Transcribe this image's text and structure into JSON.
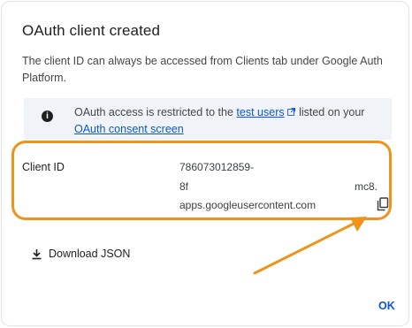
{
  "dialog": {
    "title": "OAuth client created",
    "description": "The client ID can always be accessed from Clients tab under Google Auth Platform."
  },
  "notice": {
    "icon": "info-icon",
    "text_before_link": "OAuth access is restricted to the ",
    "test_users_link": "test users",
    "text_between": " listed on your ",
    "consent_link": "OAuth consent screen"
  },
  "client": {
    "label": "Client ID",
    "line1": "786073012859-",
    "line2": "8f",
    "line2_tail": "mc8.",
    "line3": "apps.googleusercontent.com",
    "copy_icon": "copy-icon"
  },
  "actions": {
    "download_label": "Download JSON",
    "ok_label": "OK"
  },
  "annotation": {
    "highlight_color": "#f0921c",
    "arrow_color": "#f0921c"
  },
  "colors": {
    "link": "#0b57d0",
    "notice_bg": "#f0f4f9"
  }
}
